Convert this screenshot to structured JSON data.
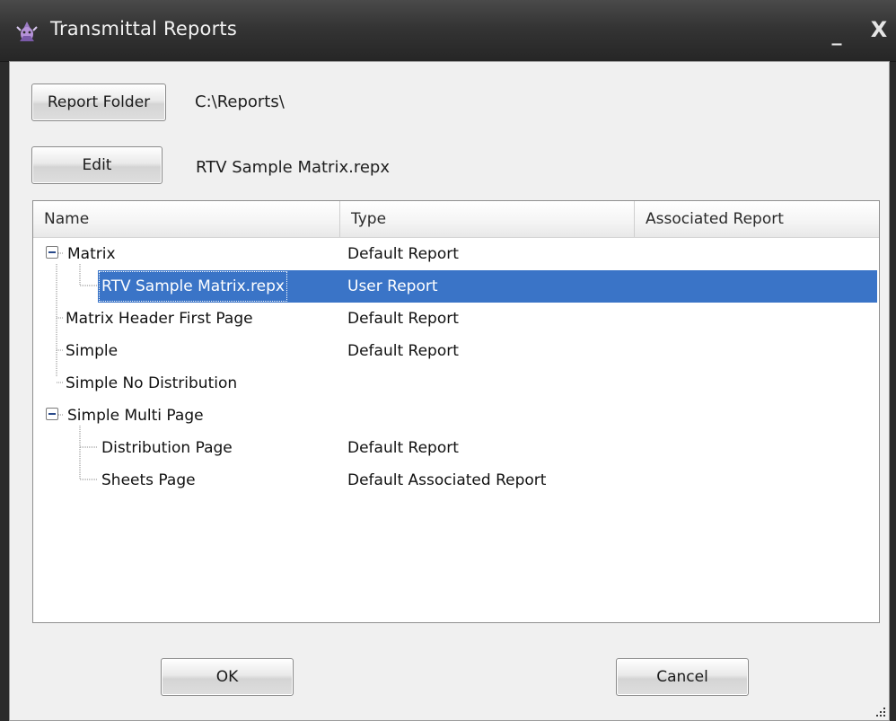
{
  "window": {
    "title": "Transmittal Reports",
    "minimize_glyph": "_",
    "close_glyph": "X"
  },
  "report_folder": {
    "button_label": "Report Folder",
    "path": "C:\\Reports\\"
  },
  "edit": {
    "button_label": "Edit",
    "report_name": "RTV Sample Matrix.repx"
  },
  "tree": {
    "columns": [
      "Name",
      "Type",
      "Associated Report"
    ],
    "rows": [
      {
        "name": "Matrix",
        "type": "Default Report",
        "level": 0,
        "expander": "collapse"
      },
      {
        "name": "RTV Sample Matrix.repx",
        "type": "User Report",
        "level": 1,
        "selected": true
      },
      {
        "name": "Matrix Header First Page",
        "type": "Default Report",
        "level": 0
      },
      {
        "name": "Simple",
        "type": "Default Report",
        "level": 0
      },
      {
        "name": "Simple No Distribution",
        "type": "",
        "level": 0
      },
      {
        "name": "Simple Multi Page",
        "type": "",
        "level": 0,
        "expander": "collapse"
      },
      {
        "name": "Distribution Page",
        "type": "Default Report",
        "level": 1
      },
      {
        "name": "Sheets Page",
        "type": "Default Associated Report",
        "level": 1
      }
    ]
  },
  "footer": {
    "ok_label": "OK",
    "cancel_label": "Cancel"
  },
  "colors": {
    "titlebar": "#343434",
    "client_bg": "#f0f0f0",
    "selection": "#3a74c7",
    "tree_lines": "#8a8a8a"
  },
  "icons": {
    "app": "wizard-app-icon",
    "expander": "minus-expander-icon",
    "resize": "size-grip-icon"
  }
}
